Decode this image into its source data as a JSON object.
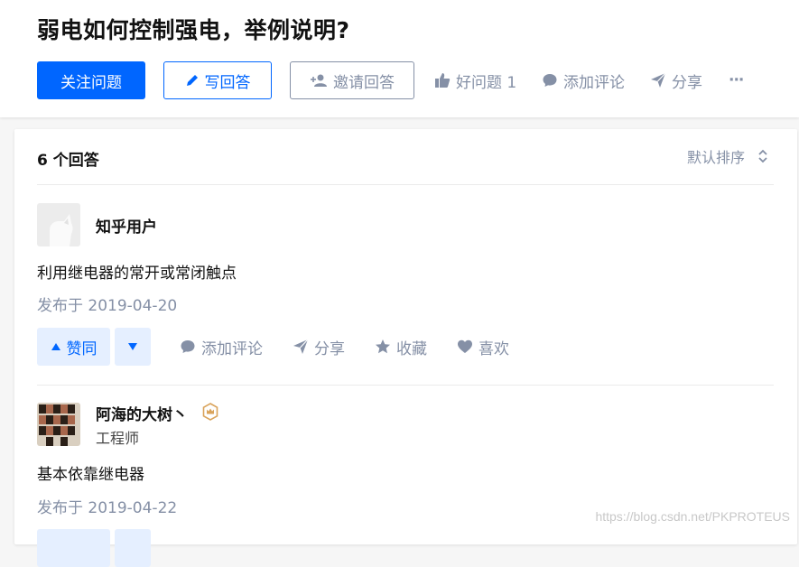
{
  "question": {
    "title": "弱电如何控制强电，举例说明?",
    "follow_label": "关注问题",
    "write_label": "写回答",
    "invite_label": "邀请回答",
    "good_question_label": "好问题 1",
    "comment_label": "添加评论",
    "share_label": "分享",
    "more_label": "···"
  },
  "answers_header": {
    "count_label": "6 个回答",
    "sort_label": "默认排序"
  },
  "answers": [
    {
      "author": "知乎用户",
      "headline": "",
      "content": "利用继电器的常开或常闭触点",
      "date": "发布于 2019-04-20",
      "vote_label": "赞同",
      "comment_label": "添加评论",
      "share_label": "分享",
      "collect_label": "收藏",
      "like_label": "喜欢"
    },
    {
      "author": "阿海的大树丶",
      "headline": "工程师",
      "content": "基本依靠继电器",
      "date": "发布于 2019-04-22"
    }
  ],
  "watermark": "https://blog.csdn.net/PKPROTEUS",
  "colors": {
    "brand": "#0066ff",
    "muted": "#8590a6",
    "vote_bg": "#e5efff",
    "badge": "#d9a35a"
  }
}
